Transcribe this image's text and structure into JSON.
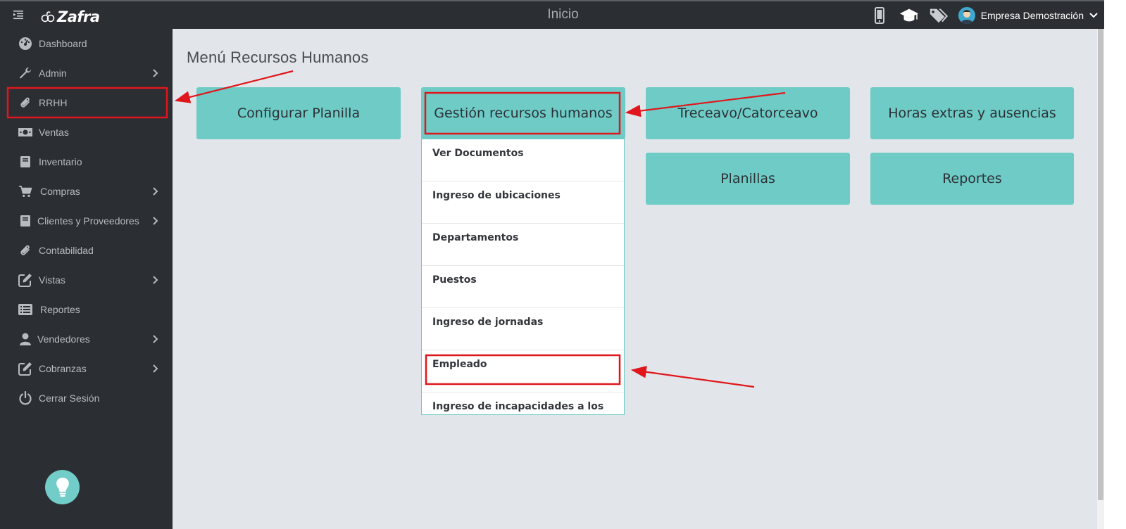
{
  "app": {
    "logo_text": "Zafra",
    "page_title": "Inicio"
  },
  "header": {
    "user_name": "Empresa Demostración",
    "icons": [
      "mobile-icon",
      "graduation-cap-icon",
      "tags-icon",
      "avatar"
    ]
  },
  "sidebar": {
    "items": [
      {
        "label": "Dashboard",
        "icon": "dashboard-icon",
        "has_submenu": false
      },
      {
        "label": "Admin",
        "icon": "wrench-icon",
        "has_submenu": true
      },
      {
        "label": "RRHH",
        "icon": "paperclip-icon",
        "has_submenu": false
      },
      {
        "label": "Ventas",
        "icon": "money-icon",
        "has_submenu": false
      },
      {
        "label": "Inventario",
        "icon": "book-icon",
        "has_submenu": false
      },
      {
        "label": "Compras",
        "icon": "cart-icon",
        "has_submenu": true
      },
      {
        "label": "Clientes y Proveedores",
        "icon": "book-icon",
        "has_submenu": true
      },
      {
        "label": "Contabilidad",
        "icon": "paperclip-icon",
        "has_submenu": false
      },
      {
        "label": "Vistas",
        "icon": "edit-icon",
        "has_submenu": true
      },
      {
        "label": "Reportes",
        "icon": "list-icon",
        "has_submenu": false
      },
      {
        "label": "Vendedores",
        "icon": "user-icon",
        "has_submenu": true
      },
      {
        "label": "Cobranzas",
        "icon": "edit-icon",
        "has_submenu": true
      },
      {
        "label": "Cerrar Sesión",
        "icon": "power-icon",
        "has_submenu": false
      }
    ]
  },
  "main": {
    "title": "Menú Recursos Humanos",
    "tiles": [
      {
        "label": "Configurar Planilla"
      },
      {
        "label": "Gestión recursos humanos"
      },
      {
        "label": "Treceavo/Catorceavo"
      },
      {
        "label": "Horas extras y ausencias"
      },
      {
        "label": "Planillas"
      },
      {
        "label": "Reportes"
      }
    ],
    "dropdown": {
      "items": [
        "Ver Documentos",
        "Ingreso de ubicaciones",
        "Departamentos",
        "Puestos",
        "Ingreso de jornadas",
        "Empleado",
        "Ingreso de incapacidades a los"
      ]
    }
  },
  "colors": {
    "sidebar_bg": "#2b2e33",
    "tile_bg": "#6ecbc6",
    "page_bg": "#e2e6ea",
    "annotation": "#e0161c"
  }
}
